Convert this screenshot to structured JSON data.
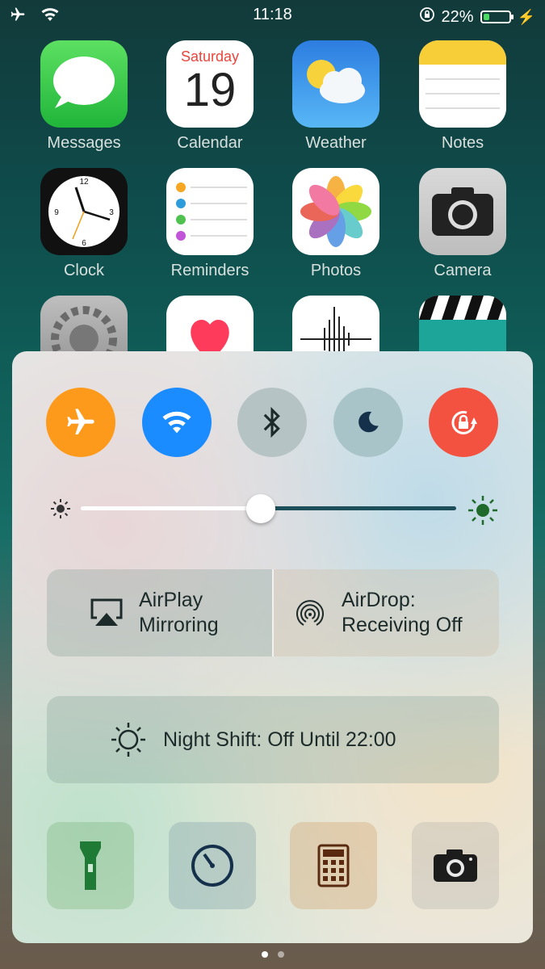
{
  "status_bar": {
    "time": "11:18",
    "battery_percent": "22%",
    "battery_level": 0.22
  },
  "home_apps": [
    {
      "label": "Messages",
      "icon": "messages-icon"
    },
    {
      "label": "Calendar",
      "icon": "calendar-icon",
      "weekday": "Saturday",
      "day": "19"
    },
    {
      "label": "Weather",
      "icon": "weather-icon"
    },
    {
      "label": "Notes",
      "icon": "notes-icon"
    },
    {
      "label": "Clock",
      "icon": "clock-icon"
    },
    {
      "label": "Reminders",
      "icon": "reminders-icon"
    },
    {
      "label": "Photos",
      "icon": "photos-icon"
    },
    {
      "label": "Camera",
      "icon": "camera-icon"
    },
    {
      "label": "",
      "icon": "settings-icon"
    },
    {
      "label": "",
      "icon": "health-icon"
    },
    {
      "label": "",
      "icon": "voice-memos-icon"
    },
    {
      "label": "",
      "icon": "videos-icon"
    }
  ],
  "control_center": {
    "toggles": [
      {
        "name": "airplane-mode",
        "icon": "airplane-icon",
        "color": "#fd9a1b",
        "on": true
      },
      {
        "name": "wifi",
        "icon": "wifi-icon",
        "color": "#1a8cff",
        "on": true
      },
      {
        "name": "bluetooth",
        "icon": "bluetooth-icon",
        "on": false
      },
      {
        "name": "do-not-disturb",
        "icon": "moon-icon",
        "on": false
      },
      {
        "name": "rotation-lock",
        "icon": "rotation-lock-icon",
        "color": "#f2523f",
        "on": true
      }
    ],
    "brightness": 0.48,
    "airplay": {
      "line1": "AirPlay",
      "line2": "Mirroring"
    },
    "airdrop": {
      "line1": "AirDrop:",
      "line2": "Receiving Off"
    },
    "night_shift": "Night Shift: Off Until 22:00",
    "tools": [
      {
        "name": "flashlight",
        "icon": "flashlight-icon"
      },
      {
        "name": "timer",
        "icon": "timer-icon"
      },
      {
        "name": "calculator",
        "icon": "calculator-icon"
      },
      {
        "name": "camera",
        "icon": "camera-icon"
      }
    ]
  },
  "page_dots": {
    "count": 2,
    "active": 0
  }
}
